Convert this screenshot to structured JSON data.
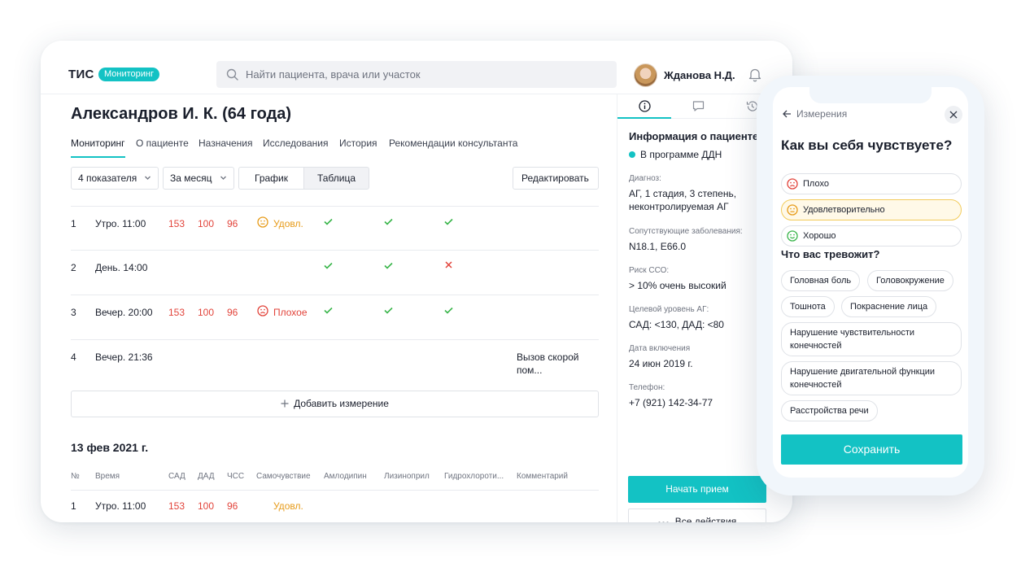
{
  "app": {
    "logo": "ТИС",
    "badge": "Мониторинг"
  },
  "search": {
    "placeholder": "Найти пациента, врача или участок"
  },
  "user": {
    "name": "Жданова Н.Д."
  },
  "patient": {
    "title": "Александров И. К. (64 года)"
  },
  "tabs": [
    "Мониторинг",
    "О пациенте",
    "Назначения",
    "Исследования",
    "История",
    "Рекомендации консультанта"
  ],
  "controls": {
    "indicators": "4 показателя",
    "period": "За месяц",
    "chart": "График",
    "table": "Таблица",
    "edit": "Редактировать"
  },
  "rows": [
    {
      "n": "1",
      "time": "Утро. 11:00",
      "sad": "153",
      "dad": "100",
      "hr": "96",
      "feel": "Удовл.",
      "feel_type": "ok",
      "med1": "ok",
      "med2": "ok",
      "med3": "ok",
      "comment": ""
    },
    {
      "n": "2",
      "time": "День. 14:00",
      "sad": "",
      "dad": "",
      "hr": "",
      "feel": "",
      "feel_type": "",
      "med1": "ok",
      "med2": "ok",
      "med3": "no",
      "comment": ""
    },
    {
      "n": "3",
      "time": "Вечер. 20:00",
      "sad": "153",
      "dad": "100",
      "hr": "96",
      "feel": "Плохое",
      "feel_type": "bad",
      "med1": "ok",
      "med2": "ok",
      "med3": "ok",
      "comment": ""
    },
    {
      "n": "4",
      "time": "Вечер. 21:36",
      "sad": "",
      "dad": "",
      "hr": "",
      "feel": "",
      "feel_type": "",
      "med1": "",
      "med2": "",
      "med3": "",
      "comment": "Вызов скорой пом..."
    }
  ],
  "add_measurement": "Добавить измерение",
  "date_heading": "13 фев 2021 г.",
  "columns": [
    "№",
    "Время",
    "САД",
    "ДАД",
    "ЧСС",
    "Самочувствие",
    "Амлодипин",
    "Лизиноприл",
    "Гидрохлороти...",
    "Комментарий"
  ],
  "peek_row": {
    "n": "1",
    "time": "Утро. 11:00",
    "sad": "153",
    "dad": "100",
    "hr": "96",
    "feel": "Удовл."
  },
  "panel": {
    "title": "Информация о пациенте",
    "program": "В программе ДДН",
    "fields": [
      {
        "label": "Диагноз:",
        "value": "АГ, 1 стадия, 3 степень, неконтролируемая АГ"
      },
      {
        "label": "Сопутствующие заболевания:",
        "value": "N18.1, E66.0"
      },
      {
        "label": "Риск ССО:",
        "value": "> 10% очень высокий"
      },
      {
        "label": "Целевой уровень АГ:",
        "value": "САД: <130, ДАД: <80"
      },
      {
        "label": "Дата включения",
        "value": "24 июн 2019 г."
      },
      {
        "label": "Телефон:",
        "value": "+7 (921) 142-34-77"
      }
    ],
    "start": "Начать прием",
    "all_actions": "Все действия"
  },
  "phone": {
    "back": "Измерения",
    "question": "Как вы себя чувствуете?",
    "options": [
      "Плохо",
      "Удовлетворительно",
      "Хорошо"
    ],
    "selected": "Удовлетворительно",
    "concern_title": "Что вас тревожит?",
    "chips": [
      "Головная боль",
      "Головокружение",
      "Тошнота",
      "Покраснение лица",
      "Нарушение чувствительности конечностей",
      "Нарушение двигательной функции конечностей",
      "Расстройства речи"
    ],
    "save": "Сохранить"
  },
  "colors": {
    "accent": "#13c2c4",
    "danger": "#e2433a",
    "warning": "#e79b18",
    "success": "#39b54a"
  }
}
